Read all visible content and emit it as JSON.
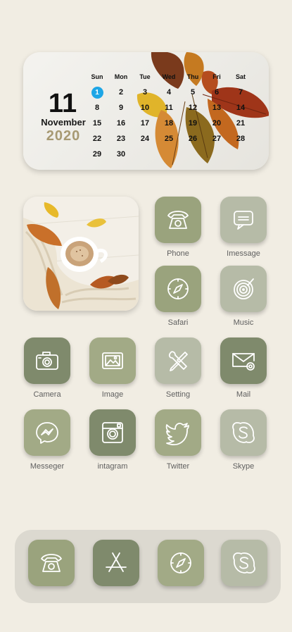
{
  "calendar": {
    "day": "11",
    "month": "November",
    "year": "2020",
    "weekdays": [
      "Sun",
      "Mon",
      "Tue",
      "Wed",
      "Thu",
      "Fri",
      "Sat"
    ],
    "days": [
      "1",
      "2",
      "3",
      "4",
      "5",
      "6",
      "7",
      "8",
      "9",
      "10",
      "11",
      "12",
      "13",
      "14",
      "15",
      "16",
      "17",
      "18",
      "19",
      "20",
      "21",
      "22",
      "23",
      "24",
      "25",
      "26",
      "27",
      "28",
      "29",
      "30",
      "",
      "",
      "",
      "",
      ""
    ],
    "today": "1"
  },
  "apps": {
    "phone": "Phone",
    "imessage": "Imessage",
    "safari": "Safari",
    "music": "Music",
    "camera": "Camera",
    "image": "Image",
    "setting": "Setting",
    "mail": "Mail",
    "messenger": "Messeger",
    "instagram": "intagram",
    "twitter": "Twitter",
    "skype": "Skype"
  },
  "colors": {
    "background": "#f1ede3",
    "sage": "#9aa37d",
    "sage_light": "#b6bba7",
    "sage_dark": "#7f8a6c",
    "today_dot": "#1ea6e6",
    "year": "#a79972"
  }
}
